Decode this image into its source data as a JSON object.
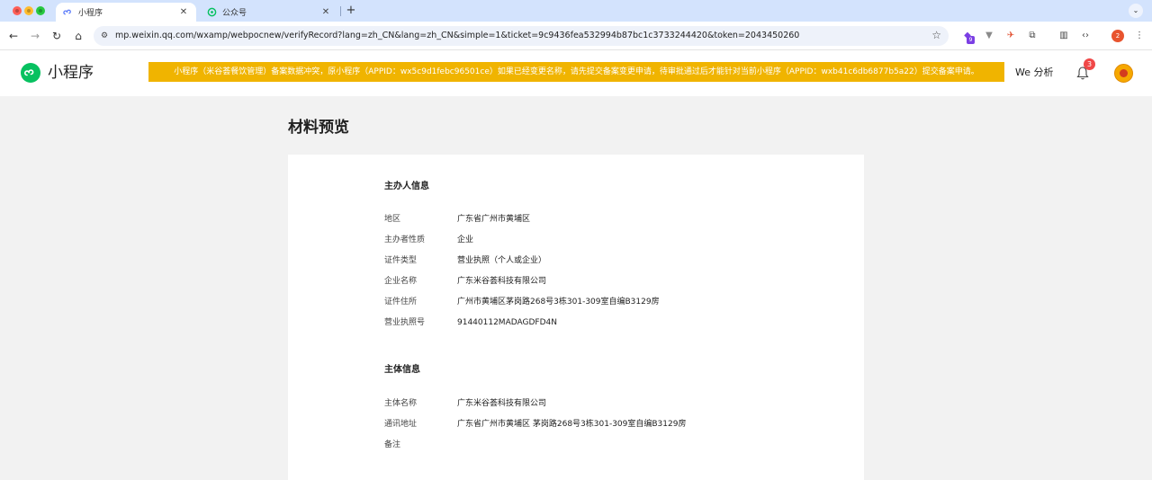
{
  "browser": {
    "tabs": [
      {
        "title": "小程序",
        "close": "✕"
      },
      {
        "title": "公众号",
        "close": "✕"
      }
    ],
    "new_tab": "+",
    "url": "mp.weixin.qq.com/wxamp/webpocnew/verifyRecord?lang=zh_CN&lang=zh_CN&simple=1&ticket=9c9436fea532994b87bc1c3733244420&token=2043450260",
    "extension_badge": "9",
    "profile_badge": "2"
  },
  "header": {
    "logo_text": "小程序",
    "notice": "小程序（米谷荟餐饮管理）备案数据冲突，原小程序（APPID：wx5c9d1febc96501ce）如果已经变更名称，请先提交备案变更申请，待审批通过后才能针对当前小程序（APPID：wxb41c6db6877b5a22）提交备案申请。",
    "we_analytics": "We 分析",
    "notification_count": "3"
  },
  "page": {
    "title": "材料预览"
  },
  "sponsor": {
    "title": "主办人信息",
    "rows": [
      {
        "label": "地区",
        "value": "广东省广州市黄埔区"
      },
      {
        "label": "主办者性质",
        "value": "企业"
      },
      {
        "label": "证件类型",
        "value": "营业执照（个人或企业）"
      },
      {
        "label": "企业名称",
        "value": "广东米谷荟科技有限公司"
      },
      {
        "label": "证件住所",
        "value": "广州市黄埔区茅岗路268号3栋301-309室自编B3129房"
      },
      {
        "label": "营业执照号",
        "value": "91440112MADAGDFD4N"
      }
    ]
  },
  "subject": {
    "title": "主体信息",
    "rows": [
      {
        "label": "主体名称",
        "value": "广东米谷荟科技有限公司"
      },
      {
        "label": "通讯地址",
        "value": "广东省广州市黄埔区 茅岗路268号3栋301-309室自编B3129房"
      },
      {
        "label": "备注",
        "value": ""
      }
    ]
  }
}
